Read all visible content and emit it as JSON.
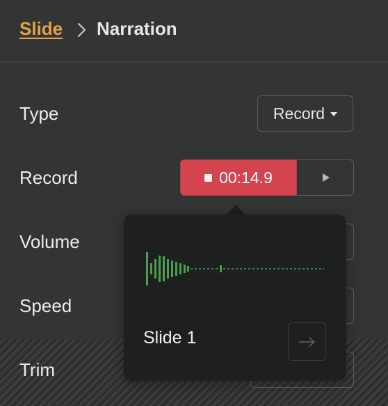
{
  "breadcrumb": {
    "parent_label": "Slide",
    "current_label": "Narration"
  },
  "rows": {
    "type_label": "Type",
    "record_label": "Record",
    "volume_label": "Volume",
    "speed_label": "Speed",
    "trim_label": "Trim"
  },
  "type_select": {
    "selected": "Record"
  },
  "recorder": {
    "timer": "00:14.9",
    "record_color": "#d4444e"
  },
  "popover": {
    "slide_name": "Slide 1",
    "waveform_color": "#4f9e4f"
  },
  "colors": {
    "accent": "#e8a04b",
    "background": "#333434",
    "popover_bg": "#1e1f1f"
  }
}
